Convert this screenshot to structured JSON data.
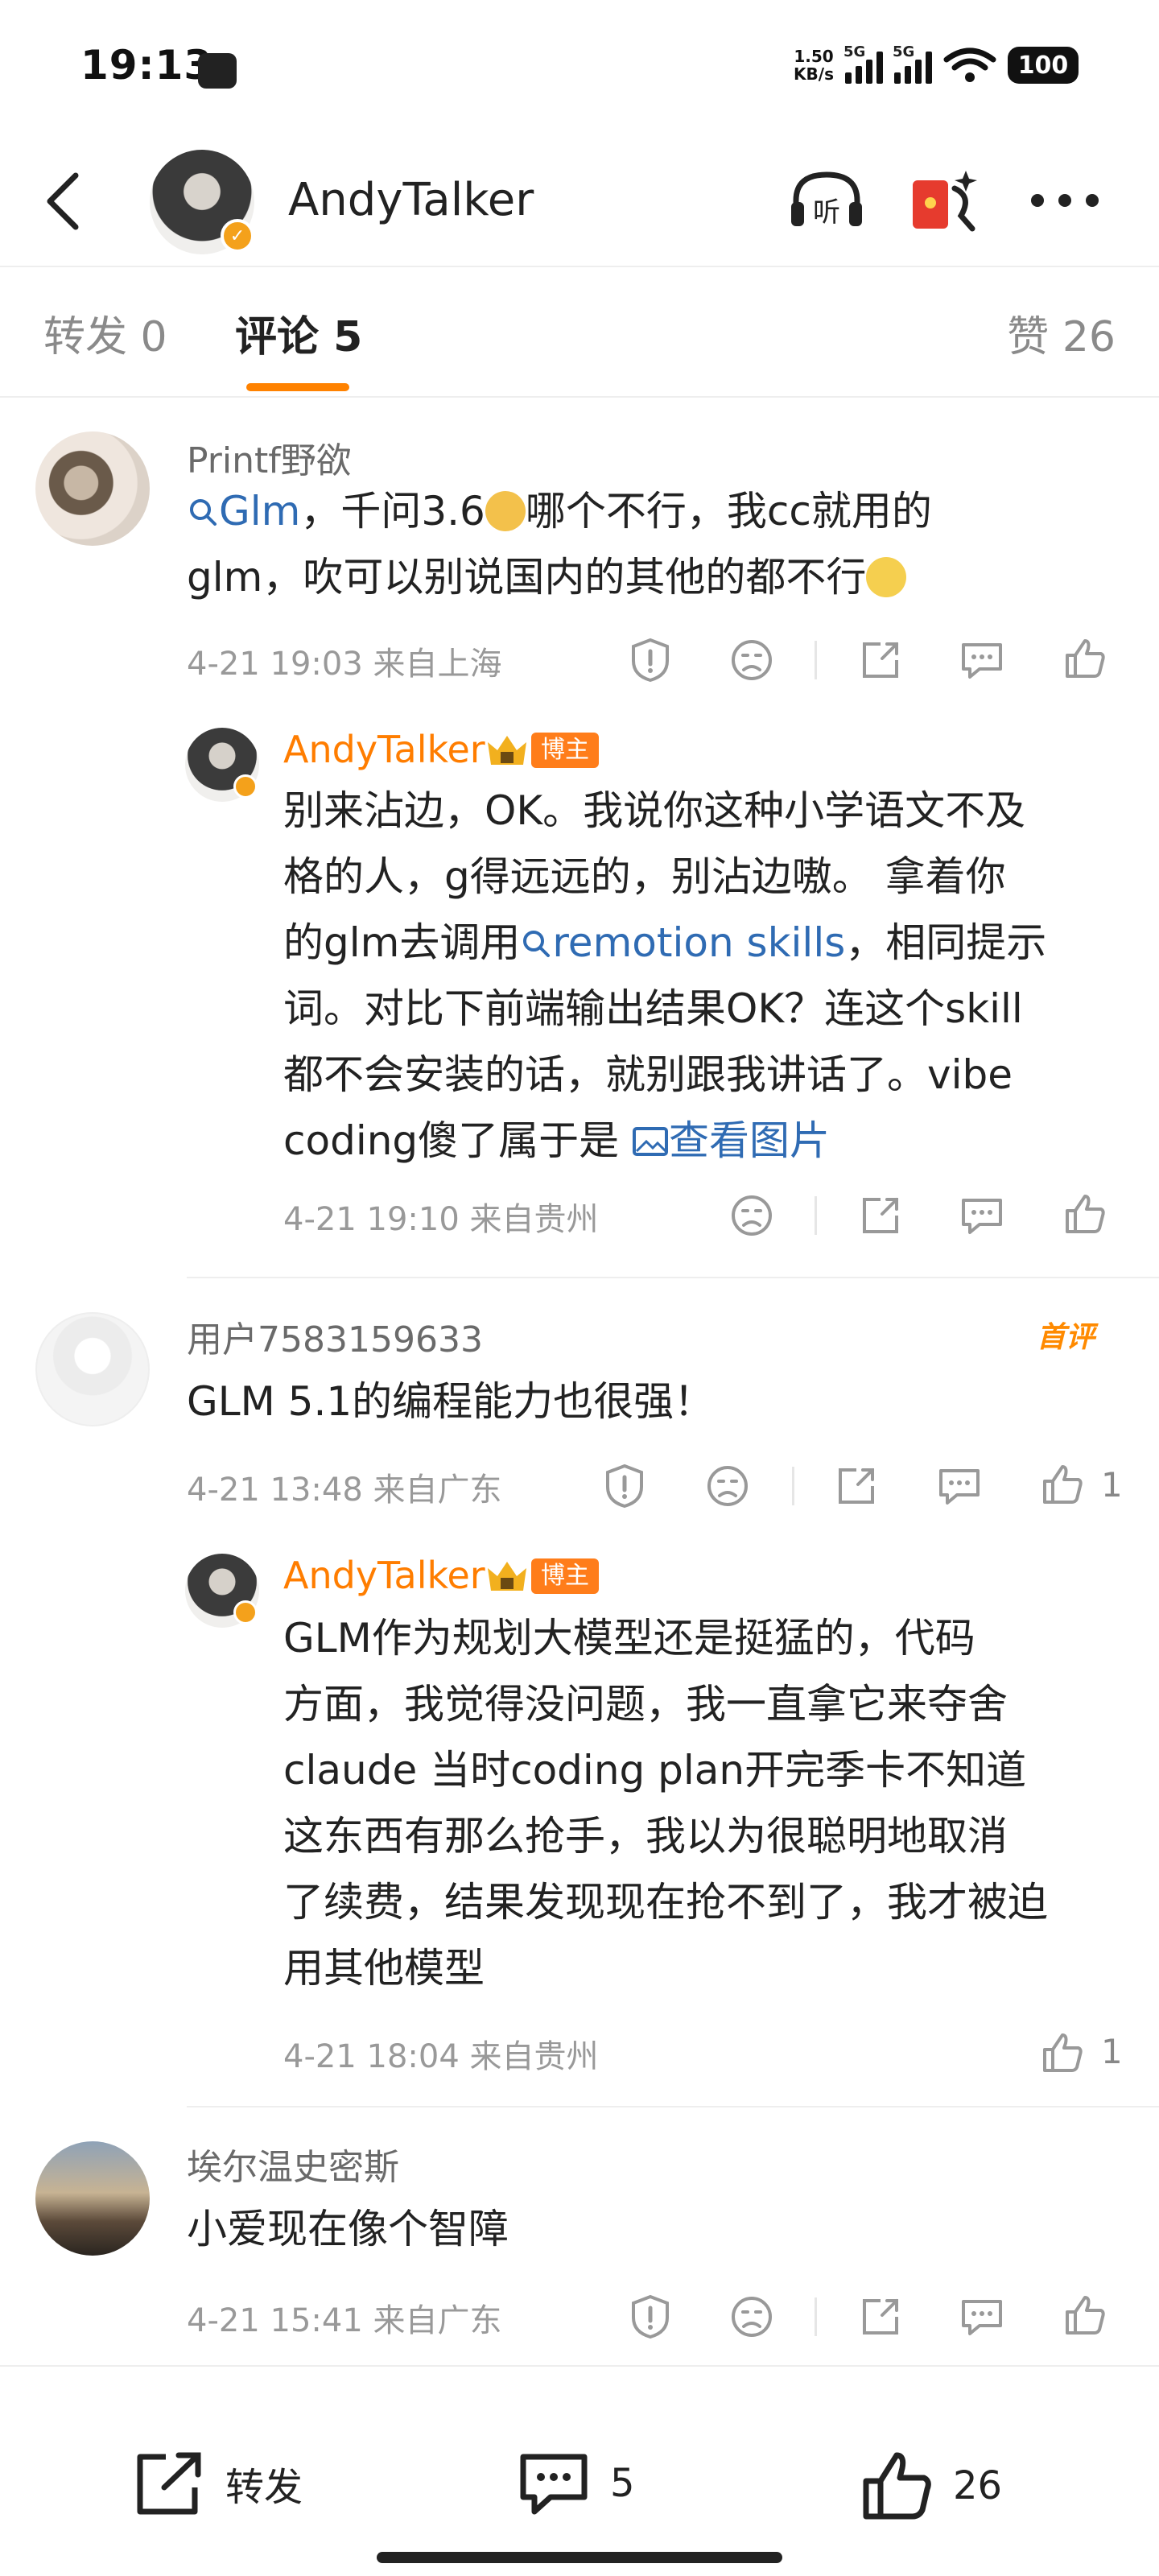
{
  "status_bar": {
    "time": "19:13",
    "speed_value": "1.50",
    "speed_unit": "KB/s",
    "signal1_label": "5G",
    "signal2_label": "5G",
    "battery": "100"
  },
  "header": {
    "username": "AndyTalker",
    "icons": [
      "back-icon",
      "headphones-listen-icon",
      "red-envelope-icon",
      "more-icon"
    ],
    "listen_label": "听"
  },
  "tabs": {
    "repost": "转发 0",
    "comments": "评论 5",
    "likes": "赞 26"
  },
  "comments": [
    {
      "user": "Printf野欲",
      "text_parts": [
        "Glm",
        "，千问3.6",
        "哪个不行，我cc就用的",
        "glm，吹可以别说国内的其他的都不行"
      ],
      "meta": "4-21 19:03  来自上海",
      "reply": {
        "user": "AndyTalker",
        "badge": "博主",
        "lines": [
          "别来沾边，OK。我说你这种小学语文不及",
          "格的人，g得远远的，别沾边嗷。 拿着你",
          "的glm去调用",
          "remotion skills",
          "，相同提示",
          "词。对比下前端输出结果OK？连这个skill",
          "都不会安装的话，就别跟我讲话了。vibe",
          "coding傻了属于是 ",
          "查看图片"
        ],
        "meta": "4-21 19:10  来自贵州"
      }
    },
    {
      "user": "用户7583159633",
      "tag": "首评",
      "text": "GLM 5.1的编程能力也很强！",
      "meta": "4-21 13:48  来自广东",
      "like_count": "1",
      "reply": {
        "user": "AndyTalker",
        "badge": "博主",
        "lines": [
          "GLM作为规划大模型还是挺猛的，代码",
          "方面，我觉得没问题，我一直拿它来夺舍",
          "claude  当时coding plan开完季卡不知道",
          "这东西有那么抢手，我以为很聪明地取消",
          "了续费，结果发现现在抢不到了，我才被迫",
          "用其他模型"
        ],
        "meta": "4-21 18:04  来自贵州",
        "like_count": "1"
      }
    },
    {
      "user": "埃尔温史密斯",
      "text": "小爱现在像个智障",
      "meta": "4-21 15:41  来自广东"
    }
  ],
  "bottom_bar": {
    "repost_label": "转发",
    "comment_count": "5",
    "like_count": "26"
  },
  "colors": {
    "accent": "#ff8200",
    "link": "#2f6bb3",
    "meta": "#999999"
  }
}
